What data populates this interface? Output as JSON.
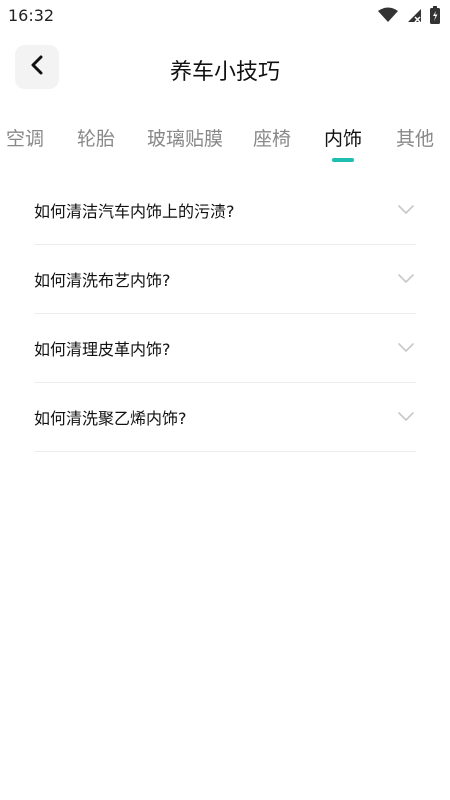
{
  "status": {
    "time": "16:32",
    "wifi_icon": "wifi-icon",
    "signal_icon": "signal-icon",
    "battery_icon": "battery-icon"
  },
  "header": {
    "title": "养车小技巧",
    "back_icon": "chevron-left-icon"
  },
  "tabs": [
    {
      "label": "空调",
      "active": false
    },
    {
      "label": "轮胎",
      "active": false
    },
    {
      "label": "玻璃贴膜",
      "active": false
    },
    {
      "label": "座椅",
      "active": false
    },
    {
      "label": "内饰",
      "active": true
    },
    {
      "label": "其他",
      "active": false
    }
  ],
  "faq": {
    "items": [
      {
        "question": "如何清洁汽车内饰上的污渍?"
      },
      {
        "question": "如何清洗布艺内饰?"
      },
      {
        "question": "如何清理皮革内饰?"
      },
      {
        "question": "如何清洗聚乙烯内饰?"
      }
    ],
    "expand_icon": "chevron-down-icon"
  },
  "colors": {
    "accent": "#1dbfb0",
    "tab_inactive": "#888888",
    "text": "#111111",
    "divider": "#ededed"
  }
}
